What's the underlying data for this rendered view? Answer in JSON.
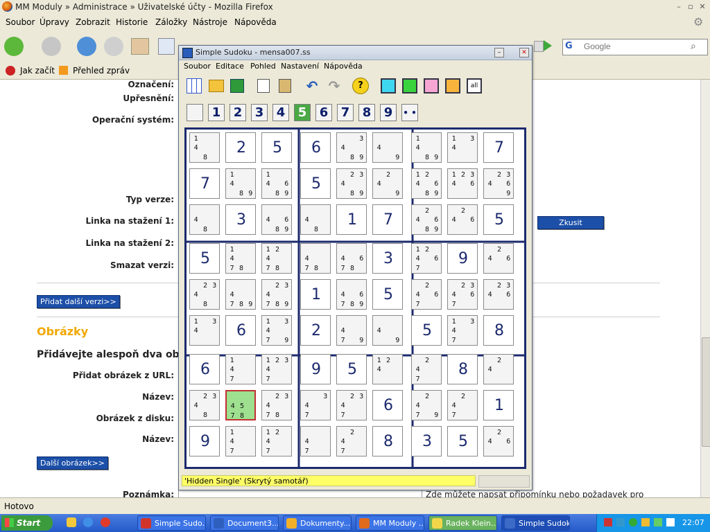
{
  "browser": {
    "title": "MM Moduly » Administrace » Uživatelské účty - Mozilla Firefox",
    "menu": [
      "Soubor",
      "Úpravy",
      "Zobrazit",
      "Historie",
      "Záložky",
      "Nástroje",
      "Nápověda"
    ],
    "search_placeholder": "Google",
    "bookmarks": [
      "Jak začít",
      "Přehled zpráv"
    ],
    "status": "Hotovo"
  },
  "page": {
    "labels": {
      "oznaceni": "Označení:",
      "upresneni": "Upřesnění:",
      "os": "Operační systém:",
      "typ_verze": "Typ verze:",
      "linka1": "Linka na stažení 1:",
      "linka2": "Linka na stažení 2:",
      "smazat": "Smazat verzi:",
      "pridat_url": "Přidat obrázek z URL:",
      "nazev1": "Název:",
      "obrazek_disk": "Obrázek z disku:",
      "nazev2": "Název:",
      "poznamka": "Poznámka:"
    },
    "add_version_button": "Přidat další verzi>>",
    "images_heading": "Obrázky",
    "images_subheading": "Přidávejte alespoň dva obráz",
    "next_image_button": "Další obrázek>>",
    "try_button": "Zkusit",
    "note_hint": "Zde můžete napsat připomínku nebo požadavek pro"
  },
  "sudoku": {
    "title": "Simple Sudoku - mensa007.ss",
    "menu": [
      "Soubor",
      "Editace",
      "Pohled",
      "Nastavení",
      "Nápověda"
    ],
    "toolbar_all_label": "all",
    "toolbar_help_label": "?",
    "digit_buttons": [
      "1",
      "2",
      "3",
      "4",
      "5",
      "6",
      "7",
      "8",
      "9"
    ],
    "selected_digit": "5",
    "status": "'Hidden Single' (Skrytý samotář)",
    "selected_cell": {
      "row": 7,
      "col": 1
    },
    "grid": [
      [
        "c:14 8",
        "2",
        "5",
        "6",
        "c:4 3 89",
        "c:4 9",
        "c:14 89",
        "c:1 34",
        "7"
      ],
      [
        "7",
        "c:14 89",
        "c:14 6 89",
        "5",
        "c:23 4 89",
        "c:2 4 9",
        "c:12 4 6 89",
        "c:123 4 6",
        "c:23 4 6 9"
      ],
      [
        "c:4 8",
        "3",
        "c:4 6 89",
        "c:4 8",
        "1",
        "7",
        "c:2 4 6 89",
        "c:2 4 6",
        "5"
      ],
      [
        "5",
        "c:14 78",
        "c:12 4 78",
        "c:4 78",
        "c:4 6 78",
        "3",
        "c:12 4 6 7",
        "9",
        "c:2 4 6"
      ],
      [
        "c:23 4 8",
        "c:4 789",
        "c:23 4 789",
        "1",
        "c:4 6 789",
        "5",
        "c:2 4 6 7",
        "c:23 4 6 7",
        "c:23 4 6"
      ],
      [
        "c:1 3 4",
        "6",
        "c:1 3 4 7 9",
        "2",
        "c:4 7 9",
        "c:4 9",
        "5",
        "c:1 3 4 7",
        "8"
      ],
      [
        "6",
        "c:14 7",
        "c:123 4 7",
        "9",
        "5",
        "c:12 4",
        "c:2 4 7",
        "8",
        "c:2 4"
      ],
      [
        "c:23 4 8",
        "c:45 78",
        "c:23 4 78",
        "c:3 4 7",
        "c:23 4 7",
        "6",
        "c:2 4 7 9",
        "c:2 4 7",
        "1"
      ],
      [
        "9",
        "c:14 7",
        "c:12 4 7",
        "c:4 7",
        "c:2 4 7",
        "8",
        "3",
        "5",
        "c:2 4 6"
      ]
    ]
  },
  "taskbar": {
    "start": "Start",
    "items": [
      "Simple Sudo...",
      "Document3...",
      "Dokumenty...",
      "MM Moduly ...",
      "Radek Klein...",
      "Simple Sudoku"
    ],
    "clock": "22:07"
  }
}
